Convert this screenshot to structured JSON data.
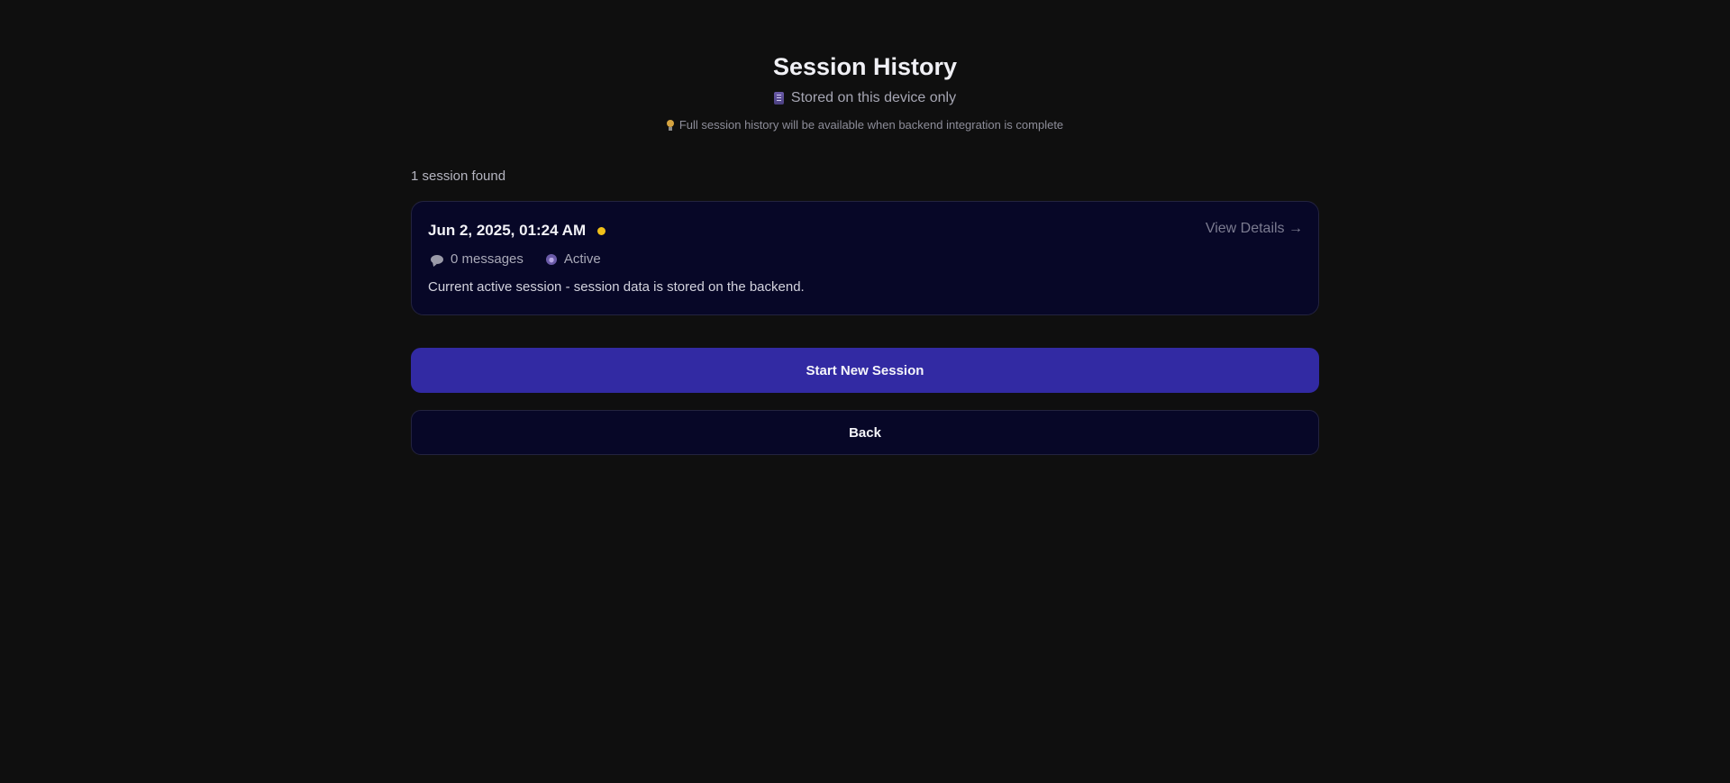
{
  "header": {
    "title": "Session History",
    "subtitle": "Stored on this device only",
    "subtitle_icon": "storage-icon",
    "note": "Full session history will be available when backend integration is complete",
    "note_icon": "lightbulb-icon"
  },
  "sessions": {
    "count_label": "1 session found",
    "items": [
      {
        "date": "Jun 2, 2025, 01:24 AM",
        "status_color": "#f0c019",
        "view_details_label": "View Details →",
        "messages_label": "0 messages",
        "status_label": "Active",
        "description": "Current active session - session data is stored on the backend."
      }
    ]
  },
  "actions": {
    "start_new_label": "Start New Session",
    "back_label": "Back"
  },
  "colors": {
    "background": "#0f0f0f",
    "card_background": "#070727",
    "primary_button": "#322aa3",
    "status_active": "#f0c019"
  }
}
